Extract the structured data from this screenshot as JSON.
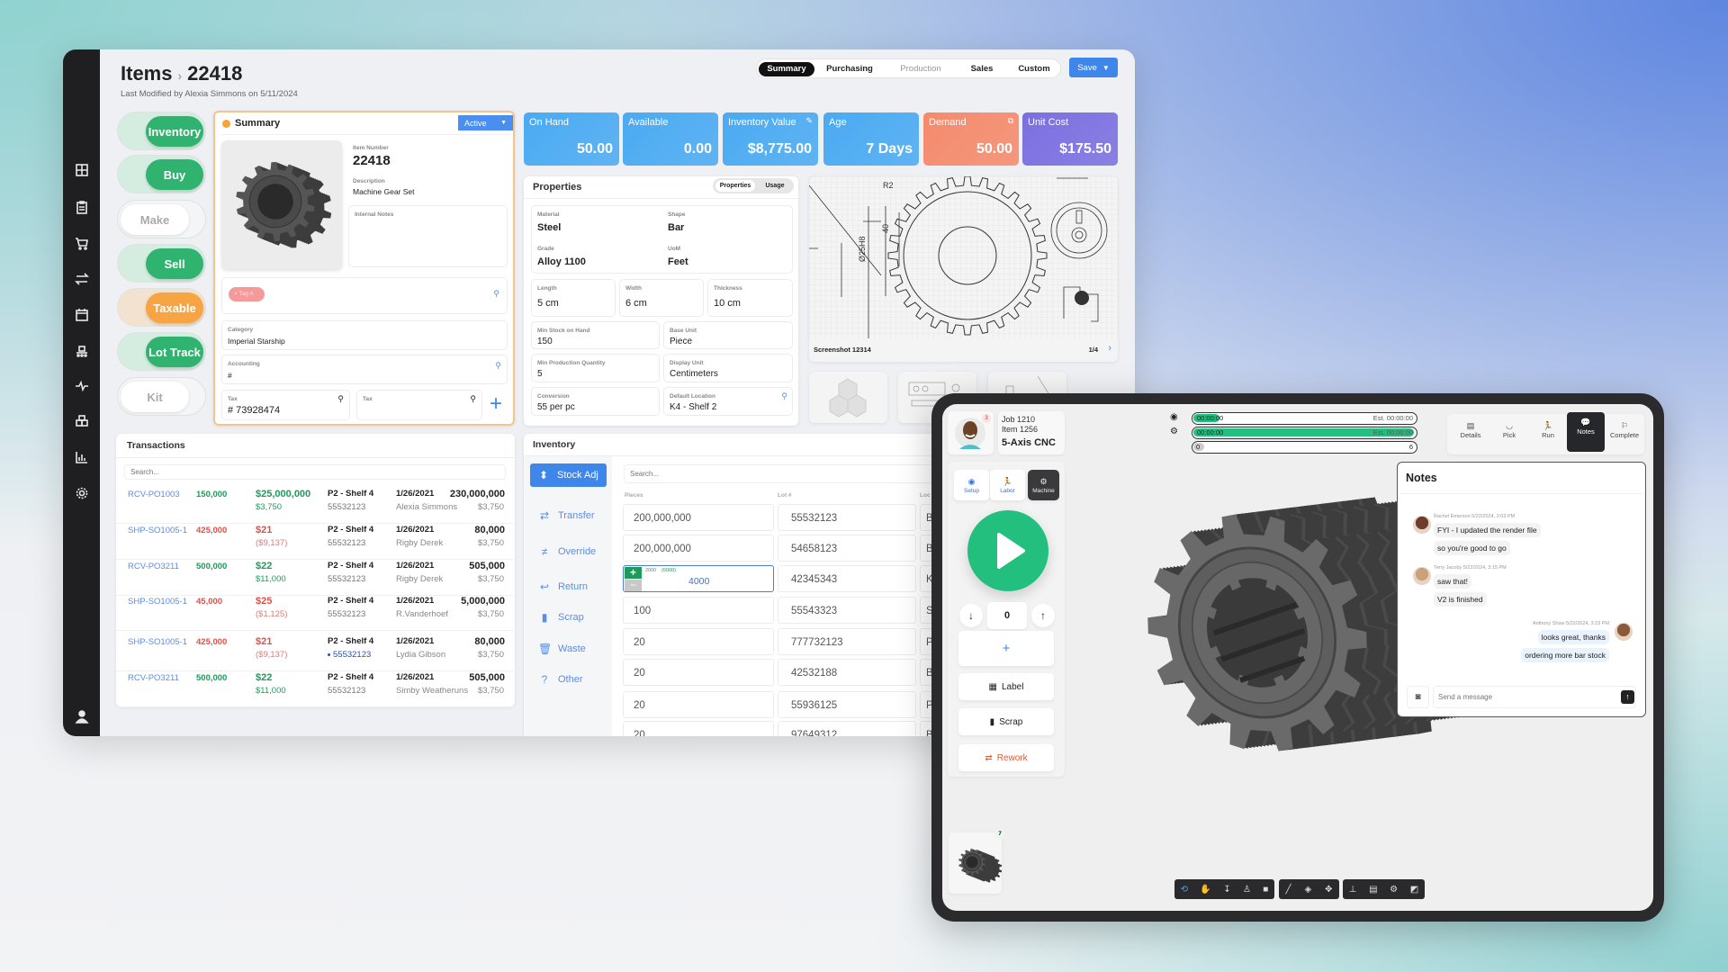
{
  "header": {
    "section": "Items",
    "separator": "›",
    "item_id": "22418",
    "subtitle": "Last Modified by Alexia Simmons on 5/11/2024"
  },
  "sidebar": {
    "icons": [
      "grid-icon",
      "clipboard-icon",
      "cart-icon",
      "transfer-icon",
      "calendar-icon",
      "conveyor-icon",
      "activity-icon",
      "boxes-icon",
      "bar-chart-icon",
      "gear-icon"
    ],
    "user_icon": "user-icon"
  },
  "tabs": {
    "items": [
      {
        "label": "Summary",
        "active": true
      },
      {
        "label": "Purchasing"
      },
      {
        "label": "Production",
        "disabled": true
      },
      {
        "label": "Sales"
      },
      {
        "label": "Custom"
      }
    ],
    "save_label": "Save"
  },
  "toggles": [
    {
      "label": "Inventory",
      "on": true,
      "color": "#2fb36f"
    },
    {
      "label": "Buy",
      "on": true,
      "color": "#2fb36f"
    },
    {
      "label": "Make",
      "on": false
    },
    {
      "label": "Sell",
      "on": true,
      "color": "#2fb36f"
    },
    {
      "label": "Taxable",
      "on": true,
      "color": "#f7a544"
    },
    {
      "label": "Lot Track",
      "on": true,
      "color": "#2fb36f"
    },
    {
      "label": "Kit",
      "on": false
    }
  ],
  "summary": {
    "title": "Summary",
    "status": "Active",
    "item_number_label": "Item Number",
    "item_number": "22418",
    "description_label": "Description",
    "description": "Machine Gear Set",
    "notes_label": "Internal Notes",
    "tag": "Tag A",
    "category_label": "Category",
    "category": "Imperial Starship",
    "accounting_label": "Accounting",
    "accounting": "#",
    "tax_label": "Tax",
    "tax_value": "# 73928474",
    "tax2_label": "Tax",
    "add": "+"
  },
  "kpis": [
    {
      "label": "On Hand",
      "value": "50.00",
      "color": "#4aaaf2"
    },
    {
      "label": "Available",
      "value": "0.00",
      "color": "#4aaaf2"
    },
    {
      "label": "Inventory Value",
      "value": "$8,775.00",
      "color": "#4aaaf2",
      "icon": "pencil-icon"
    },
    {
      "label": "Age",
      "value": "7 Days",
      "color": "#4aaaf2"
    },
    {
      "label": "Demand",
      "value": "50.00",
      "color": "#f58a6c",
      "icon": "external-link-icon"
    },
    {
      "label": "Unit Cost",
      "value": "$175.50",
      "color": "#7b6fe0"
    }
  ],
  "properties": {
    "title": "Properties",
    "toggle": [
      "Properties",
      "Usage"
    ],
    "material_label": "Material",
    "material": "Steel",
    "shape_label": "Shape",
    "shape": "Bar",
    "grade_label": "Grade",
    "grade": "Alloy 1100",
    "uom_label": "UoM",
    "uom": "Feet",
    "length_label": "Length",
    "length": "5 cm",
    "width_label": "Width",
    "width": "6 cm",
    "thickness_label": "Thickness",
    "thickness": "10 cm",
    "min_stock_label": "Min Stock on Hand",
    "min_stock": "150",
    "base_unit_label": "Base Unit",
    "base_unit": "Piece",
    "min_prod_label": "Min Production Quantity",
    "min_prod": "5",
    "display_unit_label": "Display Unit",
    "display_unit": "Centimeters",
    "conversion_label": "Conversion",
    "conversion": "55 per pc",
    "default_location_label": "Default Location",
    "default_location": "K4 - Shelf 2"
  },
  "drawing": {
    "caption": "Screenshot 12314",
    "page": "1/4",
    "dim_r": "R2",
    "dim_h": "40",
    "dim_d": "Ø25H8"
  },
  "transactions": {
    "title": "Transactions",
    "search_placeholder": "Search...",
    "rows": [
      {
        "id": "RCV-PO1003",
        "qty": "150,000",
        "amount": "$25,000,000",
        "amount_sub": "$3,750",
        "location": "P2 - Shelf 4",
        "lot": "55532123",
        "date": "1/26/2021",
        "user": "Alexia Simmons",
        "total": "230,000,000",
        "total_sub": "$3,750",
        "dir": "in"
      },
      {
        "id": "SHP-SO1005-1",
        "qty": "425,000",
        "amount": "$21",
        "amount_sub": "($9,137)",
        "location": "P2 - Shelf 4",
        "lot": "55532123",
        "date": "1/26/2021",
        "user": "Rigby Derek",
        "total": "80,000",
        "total_sub": "$3,750",
        "dir": "out"
      },
      {
        "id": "RCV-PO3211",
        "qty": "500,000",
        "amount": "$22",
        "amount_sub": "$11,000",
        "location": "P2 - Shelf 4",
        "lot": "55532123",
        "date": "1/26/2021",
        "user": "Rigby Derek",
        "total": "505,000",
        "total_sub": "$3,750",
        "dir": "in"
      },
      {
        "id": "SHP-SO1005-1",
        "qty": "45,000",
        "amount": "$25",
        "amount_sub": "($1,125)",
        "location": "P2 - Shelf 4",
        "lot": "55532123",
        "date": "1/26/2021",
        "user": "R.Vanderhoef",
        "total": "5,000,000",
        "total_sub": "$3,750",
        "dir": "out"
      },
      {
        "id": "SHP-SO1005-1",
        "qty": "425,000",
        "amount": "$21",
        "amount_sub": "($9,137)",
        "location": "P2 - Shelf 4",
        "lot": "55532123",
        "lot_linked": true,
        "date": "1/26/2021",
        "user": "Lydia Gibson",
        "total": "80,000",
        "total_sub": "$3,750",
        "dir": "out"
      },
      {
        "id": "RCV-PO3211",
        "qty": "500,000",
        "amount": "$22",
        "amount_sub": "$11,000",
        "location": "P2 - Shelf 4",
        "lot": "55532123",
        "date": "1/26/2021",
        "user": "Simby Weatheruns",
        "total": "505,000",
        "total_sub": "$3,750",
        "dir": "in"
      }
    ]
  },
  "inventory": {
    "title": "Inventory",
    "actions": [
      {
        "label": "Stock Adj",
        "icon": "up-down-icon",
        "active": true
      },
      {
        "label": "Transfer",
        "icon": "transfer-icon"
      },
      {
        "label": "Override",
        "icon": "not-equal-icon"
      },
      {
        "label": "Return",
        "icon": "return-icon"
      },
      {
        "label": "Scrap",
        "icon": "scrap-icon"
      },
      {
        "label": "Waste",
        "icon": "trash-icon"
      },
      {
        "label": "Other",
        "icon": "question-icon"
      }
    ],
    "search_placeholder": "Search...",
    "columns": [
      "Pieces",
      "Lot #",
      "Loc"
    ],
    "editing": {
      "row": 2,
      "hint": "2000",
      "hint_total": "(6000)",
      "value": "4000"
    },
    "rows": [
      {
        "pieces": "200,000,000",
        "lot": "55532123",
        "loc": "B"
      },
      {
        "pieces": "200,000,000",
        "lot": "54658123",
        "loc": "B"
      },
      {
        "pieces": "",
        "lot": "42345343",
        "loc": "K"
      },
      {
        "pieces": "100",
        "lot": "55543323",
        "loc": "S"
      },
      {
        "pieces": "20",
        "lot": "777732123",
        "loc": "P"
      },
      {
        "pieces": "20",
        "lot": "42532188",
        "loc": "B"
      },
      {
        "pieces": "20",
        "lot": "55936125",
        "loc": "P"
      },
      {
        "pieces": "20",
        "lot": "97649312",
        "loc": "B"
      }
    ]
  },
  "tablet": {
    "operator_badge": "3",
    "job": "Job 1210",
    "item": "Item 1256",
    "machine": "5-Axis CNC",
    "modes": [
      {
        "label": "Setup",
        "icon": "setup-icon"
      },
      {
        "label": "Labor",
        "icon": "runner-icon"
      },
      {
        "label": "Machine",
        "icon": "machine-icon",
        "active": true
      }
    ],
    "quantity": "0",
    "add": "+",
    "label_btn": "Label",
    "scrap_btn": "Scrap",
    "rework_btn": "Rework",
    "progress": [
      {
        "icon": "setup-icon",
        "time": "00:00:00",
        "est": "Est. 00:00:00",
        "fill": 0.12
      },
      {
        "icon": "machine-icon",
        "time": "00:00:00",
        "est": "Est. 00:00:00",
        "fill": 1
      },
      {
        "count": "0",
        "total": "6",
        "fill": 0
      }
    ],
    "nav": [
      {
        "label": "Details",
        "icon": "details-icon"
      },
      {
        "label": "Pick",
        "icon": "pick-icon"
      },
      {
        "label": "Run",
        "icon": "runner-icon"
      },
      {
        "label": "Notes",
        "icon": "chat-icon",
        "active": true
      },
      {
        "label": "Complete",
        "icon": "flag-icon"
      }
    ],
    "notes": {
      "title": "Notes",
      "messages": [
        {
          "author": "Rachel Emerson 5/22/2024, 2:03 PM",
          "lines": [
            "FYI - I updated the render file",
            "so you're good to go"
          ],
          "side": "left"
        },
        {
          "author": "Terry Jacoby 5/22/2024, 3:15 PM",
          "lines": [
            "saw that!",
            "V2 is finished"
          ],
          "side": "left"
        },
        {
          "author": "Anthony Shaw 5/22/2024, 3:23 PM",
          "lines": [
            "looks great, thanks",
            "ordering more bar stock"
          ],
          "side": "right"
        }
      ],
      "input_placeholder": "Send a message"
    },
    "model_badge": "7",
    "toolbar": [
      [
        "orbit-icon",
        "pan-icon",
        "zoom-icon",
        "walk-icon",
        "camera-icon"
      ],
      [
        "measure-icon",
        "section-icon",
        "explode-icon"
      ],
      [
        "tree-icon",
        "properties-icon",
        "settings-icon",
        "fullscreen-icon"
      ]
    ]
  }
}
